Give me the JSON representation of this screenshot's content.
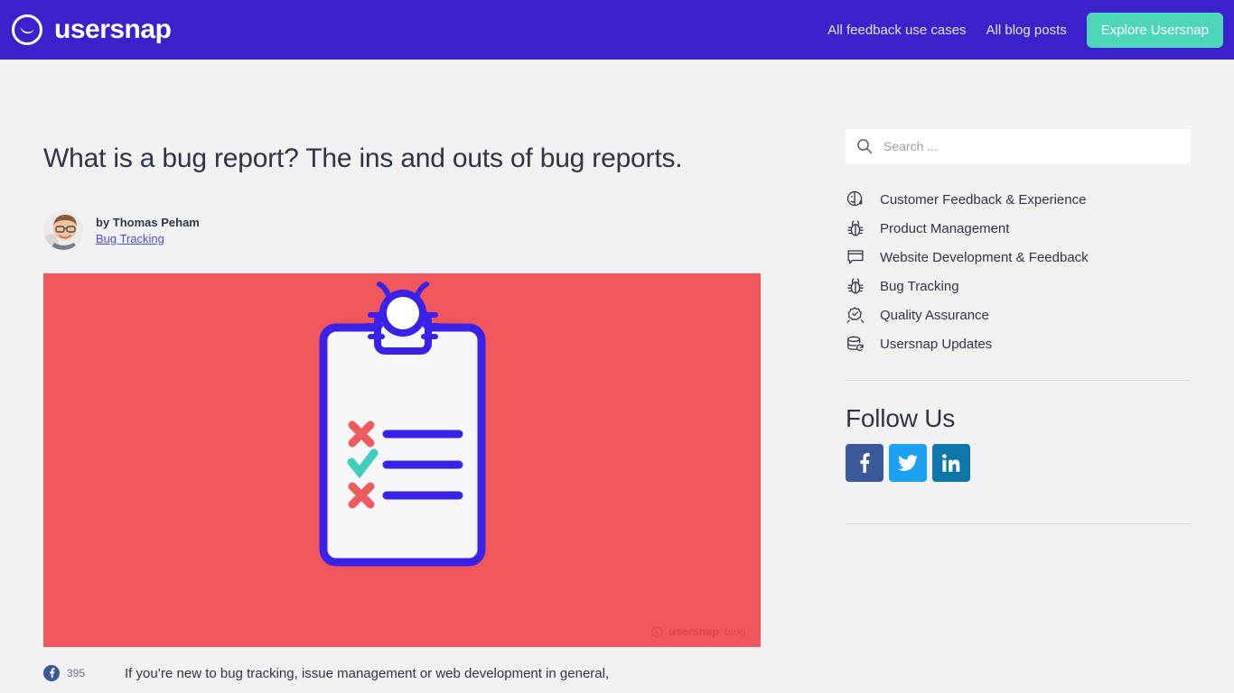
{
  "header": {
    "brand_name": "usersnap",
    "brand_icon": "usersnap-smile-logo",
    "nav": [
      {
        "label": "All feedback use cases"
      },
      {
        "label": "All blog posts"
      }
    ],
    "cta_label": "Explore Usersnap",
    "colors": {
      "background": "#3b21cb",
      "cta_background": "#4ed6b8",
      "cta_text": "#ffffff"
    }
  },
  "article": {
    "title": "What is a bug report? The ins and outs of bug reports.",
    "author": "by Thomas Peham",
    "category_link": "Bug Tracking",
    "avatar_alt": "Thomas Peham",
    "hero": {
      "alt": "Clipboard with a bug-shaped clip and a checklist of crosses and a checkmark",
      "background": "#f1565c",
      "watermark_bold": "usersnap",
      "watermark_light": "blog",
      "accent_blue": "#3a21e8",
      "accent_red": "#ef5a5e",
      "accent_teal": "#3fcfba",
      "paper": "#f7f7f9"
    },
    "share": {
      "network": "facebook",
      "count": "395"
    },
    "body": "If you’re new to bug tracking, issue management or web development in general,"
  },
  "sidebar": {
    "search": {
      "placeholder": "Search ...",
      "value": ""
    },
    "categories": [
      {
        "label": "Customer Feedback & Experience",
        "icon": "feedback-face-icon"
      },
      {
        "label": "Product Management",
        "icon": "bug-icon"
      },
      {
        "label": "Website Development & Feedback",
        "icon": "browser-chat-icon"
      },
      {
        "label": "Bug Tracking",
        "icon": "bug-icon"
      },
      {
        "label": "Quality Assurance",
        "icon": "quality-badge-icon"
      },
      {
        "label": "Usersnap Updates",
        "icon": "database-refresh-icon"
      }
    ],
    "follow": {
      "title": "Follow Us",
      "links": [
        {
          "network": "Facebook",
          "icon": "facebook-icon",
          "color": "#3b5998"
        },
        {
          "network": "Twitter",
          "icon": "twitter-icon",
          "color": "#1da1f2"
        },
        {
          "network": "LinkedIn",
          "icon": "linkedin-icon",
          "color": "#0e76a8"
        }
      ]
    }
  }
}
